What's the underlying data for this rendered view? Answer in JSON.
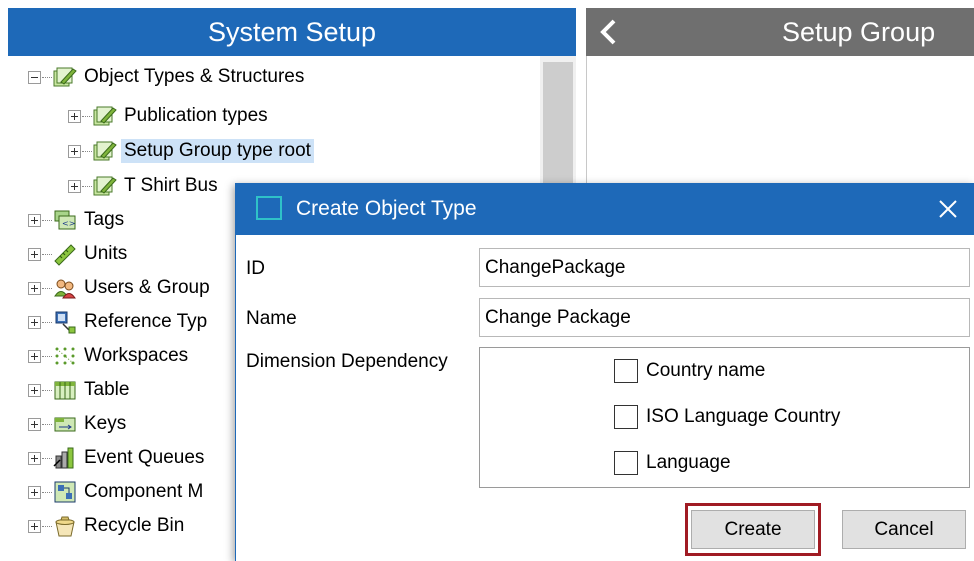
{
  "left_panel": {
    "title": "System Setup",
    "tree": [
      {
        "label": "Object Types & Structures",
        "expanded": true,
        "icon": "object-types-icon"
      },
      {
        "label": "Publication types",
        "icon": "object-types-icon"
      },
      {
        "label": "Setup Group type root",
        "icon": "object-types-icon",
        "selected": true
      },
      {
        "label": "T Shirt Bus",
        "icon": "object-types-icon"
      },
      {
        "label": "Tags",
        "icon": "tags-icon"
      },
      {
        "label": "Units",
        "icon": "ruler-icon"
      },
      {
        "label": "Users & Group",
        "icon": "users-icon"
      },
      {
        "label": "Reference Typ",
        "icon": "reference-icon"
      },
      {
        "label": "Workspaces",
        "icon": "workspaces-icon"
      },
      {
        "label": "Table",
        "icon": "table-icon"
      },
      {
        "label": "Keys",
        "icon": "keys-icon"
      },
      {
        "label": "Event Queues",
        "icon": "event-queue-icon"
      },
      {
        "label": "Component M",
        "icon": "component-icon"
      },
      {
        "label": "Recycle Bin",
        "icon": "recycle-bin-icon"
      }
    ]
  },
  "right_panel": {
    "title": "Setup Group"
  },
  "dialog": {
    "title": "Create Object Type",
    "id_label": "ID",
    "id_value": "ChangePackage",
    "name_label": "Name",
    "name_value": "Change Package",
    "dimension_label": "Dimension Dependency",
    "dimensions": [
      {
        "label": "Country name",
        "checked": false
      },
      {
        "label": "ISO Language Country",
        "checked": false
      },
      {
        "label": "Language",
        "checked": false
      }
    ],
    "create_label": "Create",
    "cancel_label": "Cancel"
  },
  "colors": {
    "header_blue": "#1e69b8",
    "header_gray": "#6f6f6f",
    "highlight_red": "#a01b23",
    "selection": "#cde2f7"
  }
}
